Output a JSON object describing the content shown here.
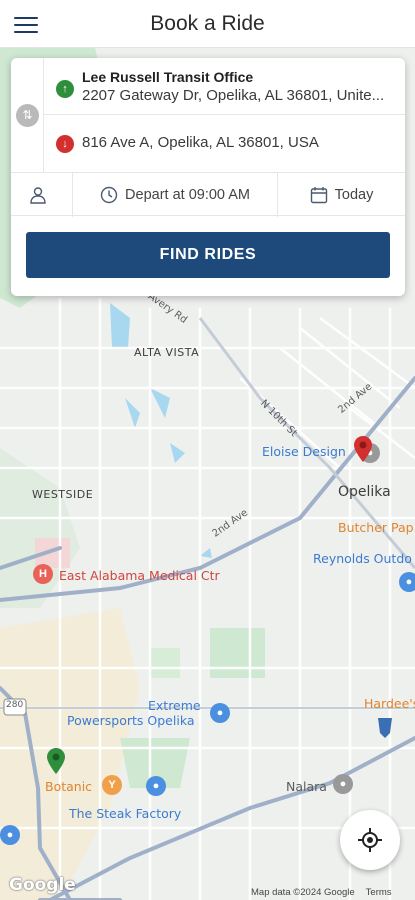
{
  "app_bar": {
    "title": "Book a Ride"
  },
  "trip": {
    "origin": {
      "name": "Lee Russell Transit Office",
      "address": "2207 Gateway Dr, Opelika, AL 36801, Unite..."
    },
    "destination": {
      "address": "816 Ave A, Opelika, AL 36801, USA"
    }
  },
  "options": {
    "depart_label": "Depart at 09:00 AM",
    "date_label": "Today"
  },
  "find_button": {
    "label": "FIND RIDES"
  },
  "map": {
    "areas": {
      "alta_vista": "ALTA VISTA",
      "westside": "WESTSIDE",
      "opelika": "Opelika"
    },
    "streets": {
      "avery_rd": "Avery Rd",
      "n_10th_st": "N 10th St",
      "second_ave_a": "2nd Ave",
      "second_ave_b": "2nd Ave"
    },
    "routes": {
      "route_280": "280"
    },
    "places": {
      "eloise_design": "Eloise Design",
      "butcher_paper": "Butcher Pap",
      "reynolds_outdoor": "Reynolds Outdo",
      "east_alabama_medical": "East Alabama Medical Ctr",
      "extreme_powersports_1": "Extreme",
      "extreme_powersports_2": "Powersports Opelika",
      "hardees": "Hardee's",
      "botanic": "Botanic",
      "steak_factory": "The Steak Factory",
      "nalara": "Nalara"
    }
  },
  "footer": {
    "google": "Google",
    "map_data": "Map data ©2024 Google",
    "terms": "Terms"
  },
  "colors": {
    "primary": "#1d4a7a",
    "origin": "#2f8e3b",
    "destination": "#d32f2f"
  }
}
